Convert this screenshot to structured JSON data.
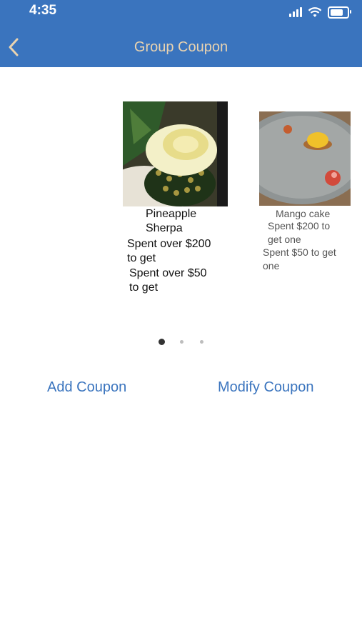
{
  "status_bar": {
    "time": "4:35",
    "icons": [
      "signal-icon",
      "wifi-icon",
      "battery-icon"
    ]
  },
  "header": {
    "title": "Group Coupon",
    "back_icon": "chevron-left-icon"
  },
  "coupons": [
    {
      "name_line1": "Pineapple",
      "name_line2": "Sherpa",
      "offer1_line1": "Spent over $200",
      "offer1_line2": "to get",
      "offer2_line1": "Spent over $50",
      "offer2_line2": "to get"
    },
    {
      "name": "Mango cake",
      "offer1_line1": "Spent $200 to",
      "offer1_line2": "get one",
      "offer2_line1": "Spent $50 to get",
      "offer2_line2": "one"
    }
  ],
  "pagination": {
    "current": 1,
    "total": 3
  },
  "actions": {
    "add_label": "Add Coupon",
    "modify_label": "Modify Coupon"
  },
  "colors": {
    "header_bg": "#3a74be",
    "title_text": "#e9d3b0",
    "link": "#3a74be"
  }
}
